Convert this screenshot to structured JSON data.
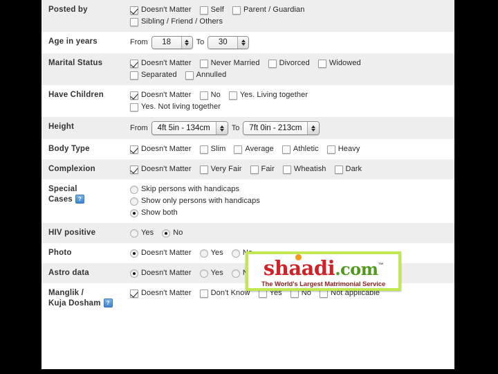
{
  "rows": [
    {
      "label": "Posted by",
      "label2": "",
      "help": false,
      "type": "checkbox",
      "lines": [
        [
          {
            "text": "Doesn't Matter",
            "checked": true
          },
          {
            "text": "Self",
            "checked": false
          },
          {
            "text": "Parent / Guardian",
            "checked": false
          }
        ],
        [
          {
            "text": "Sibling / Friend / Others",
            "checked": false
          }
        ]
      ]
    },
    {
      "label": "Age in years",
      "label2": "",
      "help": false,
      "type": "spinner",
      "from_label": "From",
      "to_label": "To",
      "from_value": "18",
      "to_value": "30"
    },
    {
      "label": "Marital Status",
      "label2": "",
      "help": false,
      "type": "checkbox",
      "lines": [
        [
          {
            "text": "Doesn't Matter",
            "checked": true
          },
          {
            "text": "Never Married",
            "checked": false
          },
          {
            "text": "Divorced",
            "checked": false
          },
          {
            "text": "Widowed",
            "checked": false
          }
        ],
        [
          {
            "text": "Separated",
            "checked": false
          },
          {
            "text": "Annulled",
            "checked": false
          }
        ]
      ]
    },
    {
      "label": "Have Children",
      "label2": "",
      "help": false,
      "type": "checkbox",
      "lines": [
        [
          {
            "text": "Doesn't Matter",
            "checked": true
          },
          {
            "text": "No",
            "checked": false
          },
          {
            "text": "Yes. Living together",
            "checked": false
          }
        ],
        [
          {
            "text": "Yes. Not living together",
            "checked": false
          }
        ]
      ]
    },
    {
      "label": "Height",
      "label2": "",
      "help": false,
      "type": "select",
      "from_label": "From",
      "to_label": "To",
      "from_value": "4ft 5in - 134cm",
      "to_value": "7ft 0in - 213cm"
    },
    {
      "label": "Body Type",
      "label2": "",
      "help": false,
      "type": "checkbox",
      "lines": [
        [
          {
            "text": "Doesn't Matter",
            "checked": true
          },
          {
            "text": "Slim",
            "checked": false
          },
          {
            "text": "Average",
            "checked": false
          },
          {
            "text": "Athletic",
            "checked": false
          },
          {
            "text": "Heavy",
            "checked": false
          }
        ]
      ]
    },
    {
      "label": "Complexion",
      "label2": "",
      "help": false,
      "type": "checkbox",
      "lines": [
        [
          {
            "text": "Doesn't Matter",
            "checked": true
          },
          {
            "text": "Very Fair",
            "checked": false
          },
          {
            "text": "Fair",
            "checked": false
          },
          {
            "text": "Wheatish",
            "checked": false
          },
          {
            "text": "Dark",
            "checked": false
          }
        ]
      ]
    },
    {
      "label": "Special",
      "label2": "Cases",
      "help": true,
      "type": "radio",
      "lines": [
        [
          {
            "text": "Skip persons with handicaps",
            "checked": false
          }
        ],
        [
          {
            "text": "Show only persons with handicaps",
            "checked": false
          }
        ],
        [
          {
            "text": "Show both",
            "checked": true
          }
        ]
      ]
    },
    {
      "label": "HIV positive",
      "label2": "",
      "help": false,
      "type": "radio",
      "lines": [
        [
          {
            "text": "Yes",
            "checked": false
          },
          {
            "text": "No",
            "checked": true
          }
        ]
      ]
    },
    {
      "label": "Photo",
      "label2": "",
      "help": false,
      "type": "radio",
      "lines": [
        [
          {
            "text": "Doesn't Matter",
            "checked": true
          },
          {
            "text": "Yes",
            "checked": false
          },
          {
            "text": "No",
            "checked": false
          }
        ]
      ]
    },
    {
      "label": "Astro data",
      "label2": "",
      "help": false,
      "type": "radio",
      "lines": [
        [
          {
            "text": "Doesn't Matter",
            "checked": true
          },
          {
            "text": "Yes",
            "checked": false
          },
          {
            "text": "No",
            "checked": false
          }
        ]
      ]
    },
    {
      "label": "Manglik /",
      "label2": "Kuja Dosham",
      "help": true,
      "type": "checkbox",
      "lines": [
        [
          {
            "text": "Doesn't Matter",
            "checked": true
          },
          {
            "text": "Don't Know",
            "checked": false
          },
          {
            "text": "Yes",
            "checked": false
          },
          {
            "text": "No",
            "checked": false
          },
          {
            "text": "Not applicable",
            "checked": false
          }
        ]
      ]
    }
  ],
  "help_icon_glyph": "?",
  "logo": {
    "brand_red": "shaadi",
    "brand_green": ".com",
    "trademark": "™",
    "tagline": "The World's Largest Matrimonial Service",
    "colors": {
      "red": "#cf2127",
      "green": "#4f9a1e",
      "orange_dot": "#f59a14",
      "border": "#c2e84f",
      "tagline": "#8d2323"
    }
  }
}
